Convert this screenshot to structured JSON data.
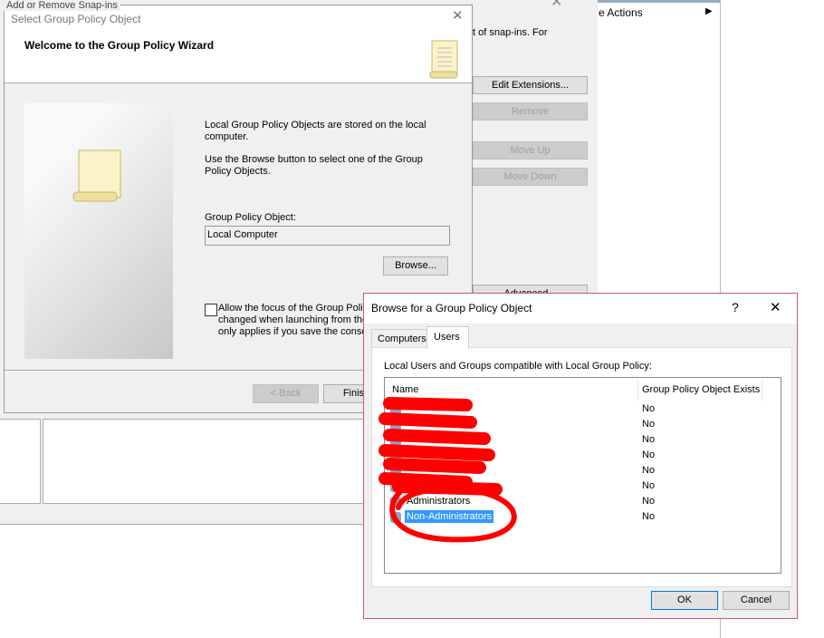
{
  "back_dialog": {
    "title": "Add or Remove Snap-ins",
    "desc_fragment": "t of snap-ins. For",
    "buttons": {
      "edit_extensions": "Edit Extensions...",
      "remove": "Remove",
      "move_up": "Move Up",
      "move_down": "Move Down",
      "advanced": "Advanced..."
    },
    "actions_label": "e Actions"
  },
  "wizard": {
    "title": "Select Group Policy Object",
    "heading": "Welcome to the Group Policy Wizard",
    "para1": "Local Group Policy Objects are stored on the local computer.",
    "para2": "Use the Browse button to select one of the Group Policy Objects.",
    "gpo_label": "Group Policy Object:",
    "gpo_value": "Local Computer",
    "browse": "Browse...",
    "checkbox_line1": "Allow the focus of the Group Polic",
    "checkbox_line2": "changed when launching from the",
    "checkbox_line3": "only applies if you save the conso",
    "checkbox_checked": false,
    "back": "< Back",
    "finish": "Finish"
  },
  "browse": {
    "title": "Browse for a Group Policy Object",
    "help": "?",
    "close": "✕",
    "tabs": [
      {
        "label": "Computers",
        "active": false
      },
      {
        "label": "Users",
        "active": true
      }
    ],
    "list_label": "Local Users and Groups compatible with Local Group Policy:",
    "columns": [
      "Name",
      "Group Policy Object Exists"
    ],
    "rows": [
      {
        "name": "",
        "exists": "No"
      },
      {
        "name": "",
        "exists": "No"
      },
      {
        "name": "",
        "exists": "No"
      },
      {
        "name": "",
        "exists": "No"
      },
      {
        "name": "",
        "exists": "No"
      },
      {
        "name": "",
        "exists": "No"
      },
      {
        "name": "Administrators",
        "exists": "No"
      },
      {
        "name": "Non-Administrators",
        "exists": "No",
        "selected": true
      }
    ],
    "ok": "OK",
    "cancel": "Cancel"
  },
  "colors": {
    "selection": "#3399ff",
    "annotation": "#ff0000",
    "dialog_border": "#c25b7c"
  }
}
